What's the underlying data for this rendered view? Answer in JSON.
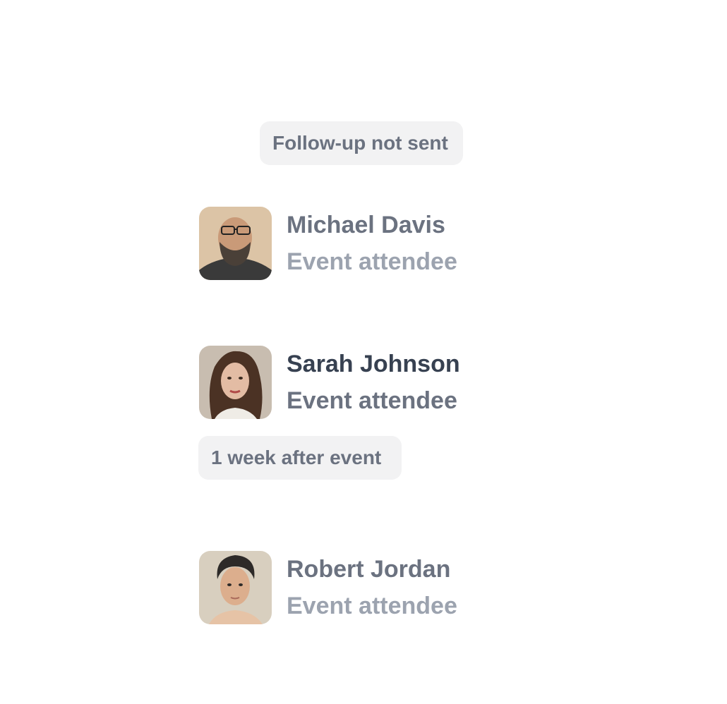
{
  "status_pill": {
    "label": "Follow-up not sent"
  },
  "timing_pill": {
    "label": "1 week after event"
  },
  "contacts": [
    {
      "name": "Michael Davis",
      "role": "Event attendee",
      "avatar": "avatar-photo-bearded-man"
    },
    {
      "name": "Sarah Johnson",
      "role": "Event attendee",
      "avatar": "avatar-photo-woman"
    },
    {
      "name": "Robert Jordan",
      "role": "Event attendee",
      "avatar": "avatar-photo-young-man"
    }
  ],
  "colors": {
    "pill_bg": "#f2f2f3",
    "pill_text": "#6b7280",
    "name_dim": "#6b7280",
    "role_dim": "#9ca3af",
    "name_active": "#374151",
    "role_active": "#6b7280"
  }
}
